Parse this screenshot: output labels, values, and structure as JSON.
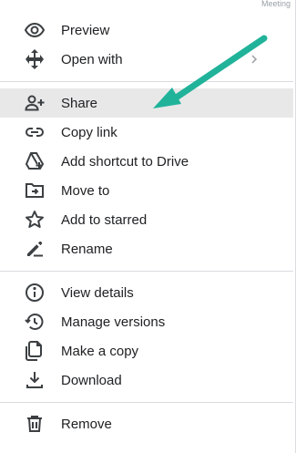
{
  "corner_text": "Meeting",
  "menu": {
    "items": [
      {
        "label": "Preview",
        "icon": "eye-icon"
      },
      {
        "label": "Open with",
        "icon": "move-arrows-icon"
      },
      {
        "label": "Share",
        "icon": "person-add-icon"
      },
      {
        "label": "Copy link",
        "icon": "link-icon"
      },
      {
        "label": "Add shortcut to Drive",
        "icon": "drive-shortcut-icon"
      },
      {
        "label": "Move to",
        "icon": "folder-move-icon"
      },
      {
        "label": "Add to starred",
        "icon": "star-icon"
      },
      {
        "label": "Rename",
        "icon": "pencil-icon"
      },
      {
        "label": "View details",
        "icon": "info-icon"
      },
      {
        "label": "Manage versions",
        "icon": "history-icon"
      },
      {
        "label": "Make a copy",
        "icon": "copy-icon"
      },
      {
        "label": "Download",
        "icon": "download-icon"
      },
      {
        "label": "Remove",
        "icon": "trash-icon"
      }
    ]
  },
  "colors": {
    "highlight": "#e8e8e8",
    "arrow": "#20b39a",
    "text": "#202124",
    "icon": "#3c4043"
  }
}
